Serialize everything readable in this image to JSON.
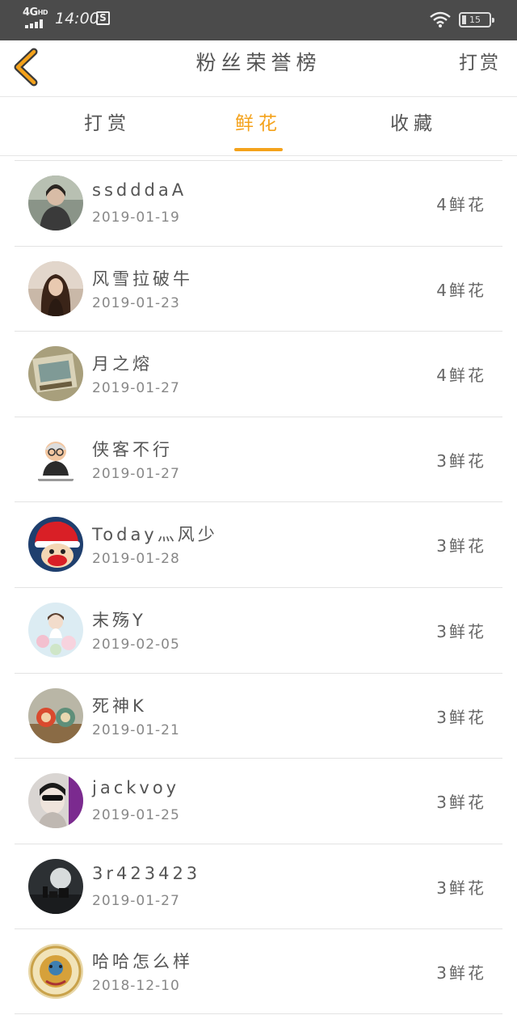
{
  "status_bar": {
    "network": "4G",
    "network_sup": "HD",
    "time": "14:00",
    "app_icon": "S",
    "battery": "15",
    "battery_level": 0.15
  },
  "header": {
    "back_icon": "chevron-left-icon",
    "title": "粉丝荣誉榜",
    "action_label": "打赏",
    "accent_color": "#f4a21b"
  },
  "tabs": [
    {
      "label": "打赏",
      "active": false
    },
    {
      "label": "鲜花",
      "active": true
    },
    {
      "label": "收藏",
      "active": false
    }
  ],
  "list": [
    {
      "name": "ssdddaA",
      "date": "2019-01-19",
      "count": "4鲜花"
    },
    {
      "name": "风雪拉破牛",
      "date": "2019-01-23",
      "count": "4鲜花"
    },
    {
      "name": "月之熔",
      "date": "2019-01-27",
      "count": "4鲜花"
    },
    {
      "name": "侠客不行",
      "date": "2019-01-27",
      "count": "3鲜花"
    },
    {
      "name": "Today灬风少",
      "date": "2019-01-28",
      "count": "3鲜花"
    },
    {
      "name": "末殇Y",
      "date": "2019-02-05",
      "count": "3鲜花"
    },
    {
      "name": "死神K",
      "date": "2019-01-21",
      "count": "3鲜花"
    },
    {
      "name": "jackvoy",
      "date": "2019-01-25",
      "count": "3鲜花"
    },
    {
      "name": "3r423423",
      "date": "2019-01-27",
      "count": "3鲜花"
    },
    {
      "name": "哈哈怎么样",
      "date": "2018-12-10",
      "count": "3鲜花"
    }
  ]
}
